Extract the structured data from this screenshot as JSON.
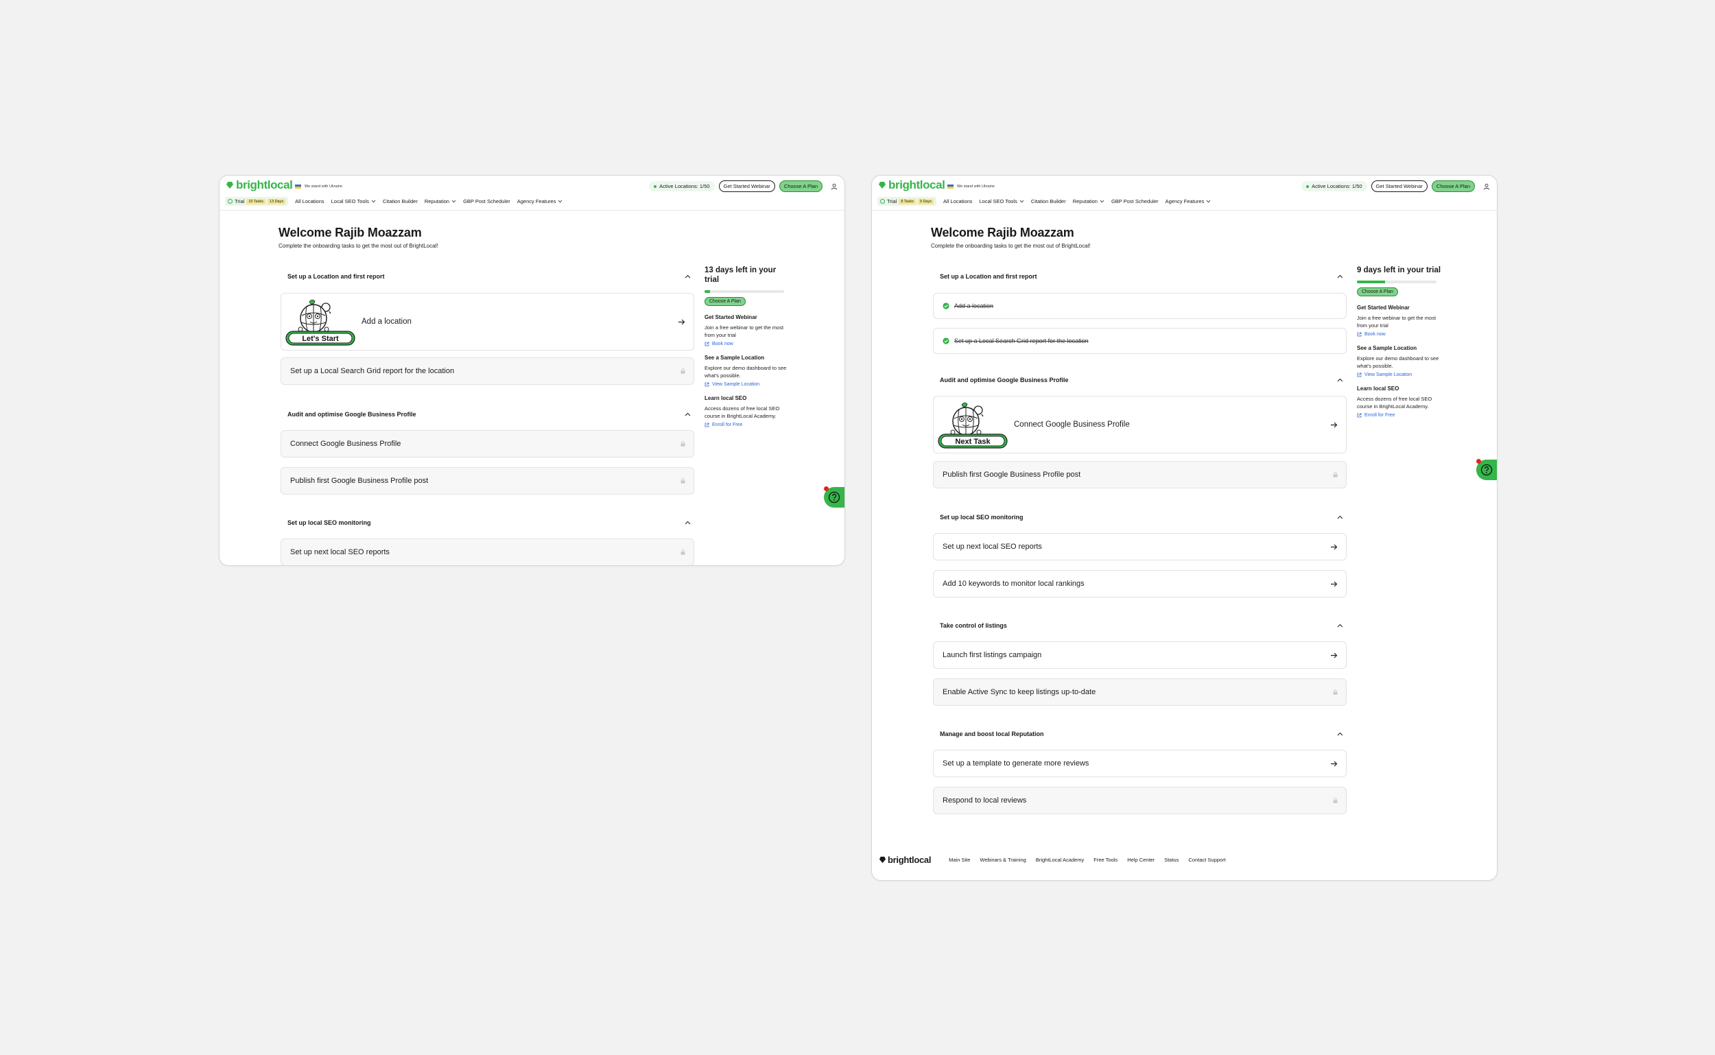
{
  "colors": {
    "brand": "#35b54a",
    "accent_button": "#7fd38a",
    "link": "#2b62d9",
    "badge_yellow": "#f6e58c",
    "notification": "#e1261c"
  },
  "header": {
    "logo": "brightlocal",
    "ukraine_text": "We stand with Ukraine",
    "get_started_webinar": "Get Started Webinar",
    "choose_plan": "Choose A Plan",
    "nav": [
      "All Locations",
      "Local SEO Tools",
      "Citation Builder",
      "Reputation",
      "GBP Post Scheduler",
      "Agency Features"
    ]
  },
  "welcome": {
    "title": "Welcome Rajib Moazzam",
    "subtitle": "Complete the onboarding tasks to get the most out of BrightLocal!"
  },
  "sidebar": {
    "choose_plan": "Choose A Plan",
    "webinar_title": "Get Started Webinar",
    "webinar_text": "Join a free webinar to get the most from your trial",
    "webinar_link": "Book now",
    "sample_title": "See a Sample Location",
    "sample_text": "Explore our demo dashboard to see what's possible.",
    "sample_link": "View Sample Location",
    "learn_title": "Learn local SEO",
    "learn_text": "Access dozens of free local SEO course in BrightLocal Academy.",
    "learn_link": "Enroll for Free"
  },
  "left": {
    "active_locations": "Active Locations: 1/50",
    "trial_label": "Trial",
    "trial_tasks_badge": "10 Tasks",
    "trial_days_badge": "13 Days",
    "days_left": "13 days left in your trial",
    "trial_progress": 0.07,
    "section1": "Set up a Location and first report",
    "mascot_label": "Let's Start",
    "task_add_location": "Add a location",
    "task_search_grid": "Set up a Local Search Grid report for the location",
    "section2": "Audit and optimise Google Business Profile",
    "task_connect_gbp": "Connect Google Business Profile",
    "task_publish_post": "Publish first Google Business Profile post",
    "section3": "Set up local SEO monitoring",
    "task_seo_reports": "Set up next local SEO reports"
  },
  "right": {
    "active_locations": "Active Locations: 1/50",
    "trial_label": "Trial",
    "trial_tasks_badge": "8 Tasks",
    "trial_days_badge": "9 Days",
    "days_left": "9 days left in your trial",
    "trial_progress": 0.35,
    "section1": "Set up a Location and first report",
    "done_add_location": "Add a location",
    "done_search_grid": "Set up a Local Search Grid report for the location",
    "section2": "Audit and optimise Google Business Profile",
    "mascot_label": "Next Task",
    "task_connect_gbp": "Connect Google Business Profile",
    "task_publish_post": "Publish first Google Business Profile post",
    "section3": "Set up local SEO monitoring",
    "task_seo_reports": "Set up next local SEO reports",
    "task_keywords": "Add 10 keywords to monitor local rankings",
    "section4": "Take control of listings",
    "task_listings_campaign": "Launch first listings campaign",
    "task_active_sync": "Enable Active Sync to keep listings up-to-date",
    "section5": "Manage and boost local Reputation",
    "task_review_template": "Set up a template to generate more reviews",
    "task_respond_reviews": "Respond to local reviews"
  },
  "footer": {
    "logo": "brightlocal",
    "links": [
      "Main Site",
      "Webinars & Training",
      "BrightLocal Academy",
      "Free Tools",
      "Help Center",
      "Status",
      "Contact Support"
    ]
  }
}
